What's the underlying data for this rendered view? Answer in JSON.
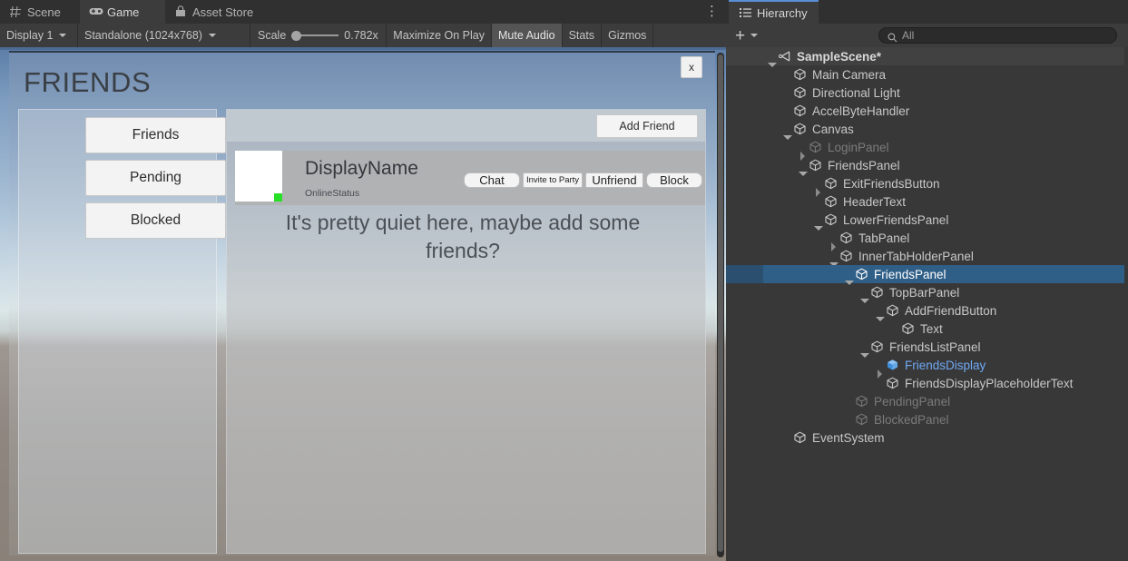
{
  "editor_tabs": [
    {
      "label": "Scene",
      "icon": "grid-icon",
      "active": false
    },
    {
      "label": "Game",
      "icon": "gamepad-icon",
      "active": true
    },
    {
      "label": "Asset Store",
      "icon": "store-icon",
      "active": false
    }
  ],
  "game_toolbar": {
    "display": "Display 1",
    "aspect": "Standalone (1024x768)",
    "scale_label": "Scale",
    "scale_value": "0.782x",
    "maximize_on_play": "Maximize On Play",
    "mute_audio": "Mute Audio",
    "stats": "Stats",
    "gizmos": "Gizmos",
    "menu_icon": "kebab-menu-icon"
  },
  "game": {
    "window_title": "FRIENDS",
    "close_label": "x",
    "tabs": [
      {
        "label": "Friends"
      },
      {
        "label": "Pending"
      },
      {
        "label": "Blocked"
      }
    ],
    "add_friend_label": "Add Friend",
    "friend_entry": {
      "display_name": "DisplayName",
      "online_status": "OnlineStatus",
      "status_color": "#28e028",
      "actions": [
        {
          "label": "Chat"
        },
        {
          "label": "Invite to Party"
        },
        {
          "label": "Unfriend"
        },
        {
          "label": "Block"
        }
      ]
    },
    "placeholder_text": "It's pretty quiet here, maybe add some friends?"
  },
  "hierarchy": {
    "tab_label": "Hierarchy",
    "tab_icon": "hierarchy-icon",
    "add_label": "+",
    "search_placeholder": "All",
    "search_value": "",
    "accent_color": "#5a8fd6",
    "selection_color": "#2f5e87",
    "prefab_color": "#6fa8f5",
    "items": [
      {
        "label": "SampleScene*",
        "depth": 0,
        "twist": "down",
        "icon": "unity-scene-icon",
        "state": "scene"
      },
      {
        "label": "Main Camera",
        "depth": 1,
        "twist": "none",
        "icon": "gameobject-icon",
        "state": "normal"
      },
      {
        "label": "Directional Light",
        "depth": 1,
        "twist": "none",
        "icon": "gameobject-icon",
        "state": "normal"
      },
      {
        "label": "AccelByteHandler",
        "depth": 1,
        "twist": "none",
        "icon": "gameobject-icon",
        "state": "normal"
      },
      {
        "label": "Canvas",
        "depth": 1,
        "twist": "down",
        "icon": "gameobject-icon",
        "state": "normal"
      },
      {
        "label": "LoginPanel",
        "depth": 2,
        "twist": "right",
        "icon": "gameobject-icon",
        "state": "dim"
      },
      {
        "label": "FriendsPanel",
        "depth": 2,
        "twist": "down",
        "icon": "gameobject-icon",
        "state": "normal"
      },
      {
        "label": "ExitFriendsButton",
        "depth": 3,
        "twist": "right",
        "icon": "gameobject-icon",
        "state": "normal"
      },
      {
        "label": "HeaderText",
        "depth": 3,
        "twist": "none",
        "icon": "gameobject-icon",
        "state": "normal"
      },
      {
        "label": "LowerFriendsPanel",
        "depth": 3,
        "twist": "down",
        "icon": "gameobject-icon",
        "state": "normal"
      },
      {
        "label": "TabPanel",
        "depth": 4,
        "twist": "right",
        "icon": "gameobject-icon",
        "state": "normal"
      },
      {
        "label": "InnerTabHolderPanel",
        "depth": 4,
        "twist": "down",
        "icon": "gameobject-icon",
        "state": "normal"
      },
      {
        "label": "FriendsPanel",
        "depth": 5,
        "twist": "down",
        "icon": "gameobject-icon",
        "state": "selected"
      },
      {
        "label": "TopBarPanel",
        "depth": 6,
        "twist": "down",
        "icon": "gameobject-icon",
        "state": "normal"
      },
      {
        "label": "AddFriendButton",
        "depth": 7,
        "twist": "down",
        "icon": "gameobject-icon",
        "state": "normal"
      },
      {
        "label": "Text",
        "depth": 8,
        "twist": "none",
        "icon": "gameobject-icon",
        "state": "normal"
      },
      {
        "label": "FriendsListPanel",
        "depth": 6,
        "twist": "down",
        "icon": "gameobject-icon",
        "state": "normal"
      },
      {
        "label": "FriendsDisplay",
        "depth": 7,
        "twist": "right",
        "icon": "prefab-icon",
        "state": "prefab"
      },
      {
        "label": "FriendsDisplayPlaceholderText",
        "depth": 7,
        "twist": "none",
        "icon": "gameobject-icon",
        "state": "normal"
      },
      {
        "label": "PendingPanel",
        "depth": 5,
        "twist": "none",
        "icon": "gameobject-icon",
        "state": "dim"
      },
      {
        "label": "BlockedPanel",
        "depth": 5,
        "twist": "none",
        "icon": "gameobject-icon",
        "state": "dim"
      },
      {
        "label": "EventSystem",
        "depth": 1,
        "twist": "none",
        "icon": "gameobject-icon",
        "state": "normal"
      }
    ]
  }
}
